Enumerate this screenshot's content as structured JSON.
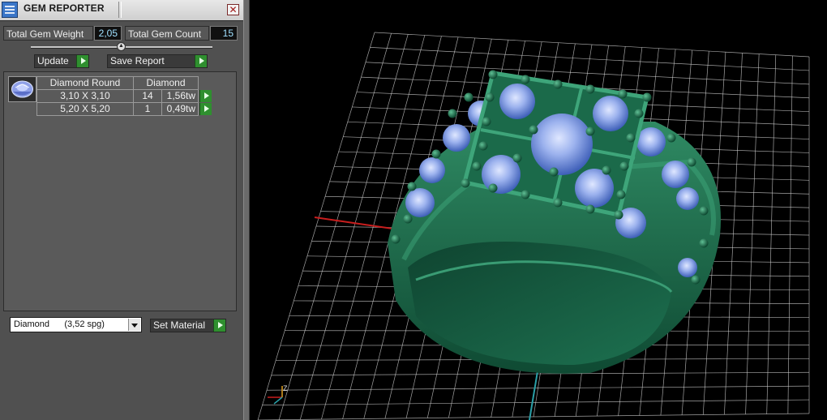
{
  "panel": {
    "title": "GEM REPORTER",
    "close_glyph": "✕",
    "total_weight_label": "Total Gem Weight",
    "total_weight_value": "2,05",
    "total_count_label": "Total Gem Count",
    "total_count_value": "15",
    "update_label": "Update",
    "save_report_label": "Save Report",
    "table": {
      "header_shape": "Diamond Round",
      "header_material": "Diamond",
      "rows": [
        {
          "size": "3,10 X 3,10",
          "count": "14",
          "weight": "1,56tw"
        },
        {
          "size": "5,20 X 5,20",
          "count": "1",
          "weight": "0,49tw"
        }
      ]
    },
    "material_select_value": "Diamond      (3,52 spg)",
    "set_material_label": "Set Material"
  },
  "viewport": {
    "axis_label": "Z",
    "colors": {
      "background": "#000000",
      "grid": "#d8d8d8",
      "axis_x": "#c81e1e",
      "axis_y": "#2aa0a8",
      "metal": "#1f6e4e",
      "gem": "#8fa7e6"
    },
    "icons": [
      "gem-thumbnail-icon",
      "app-icon",
      "play-arrow-icon",
      "dropdown-arrow-icon"
    ]
  }
}
